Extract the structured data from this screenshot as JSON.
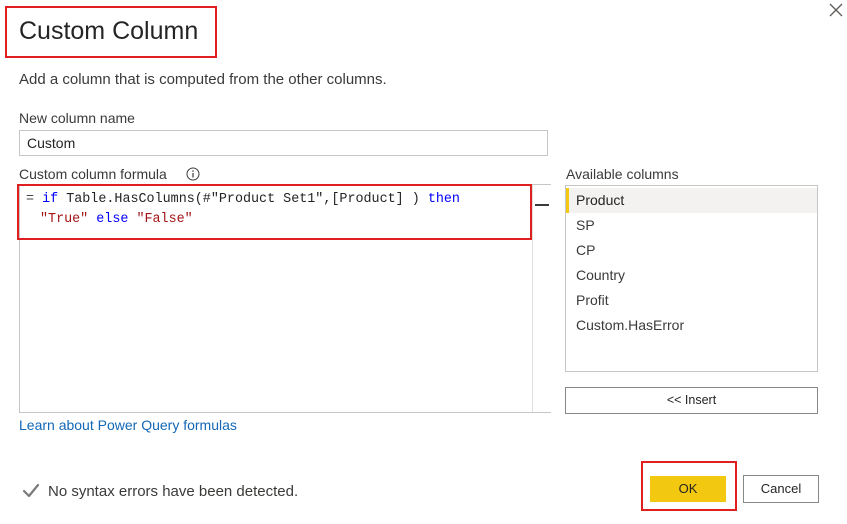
{
  "dialog": {
    "title": "Custom Column",
    "subtitle": "Add a column that is computed from the other columns."
  },
  "new_column": {
    "label": "New column name",
    "value": "Custom"
  },
  "formula": {
    "label": "Custom column formula",
    "line1": {
      "prefix": "= ",
      "if_kw": "if",
      "middle": " Table.HasColumns(#\"Product Set1\",[Product] ) ",
      "then_kw": "then"
    },
    "line2": {
      "true_str": "\"True\"",
      "else_kw": " else ",
      "false_str": "\"False\""
    }
  },
  "available_columns": {
    "label": "Available columns",
    "items": [
      "Product",
      "SP",
      "CP",
      "Country",
      "Profit",
      "Custom.HasError"
    ],
    "selected": "Product",
    "insert_label": "<< Insert"
  },
  "learn_link": "Learn about Power Query formulas",
  "status": {
    "text": "No syntax errors have been detected."
  },
  "buttons": {
    "ok": "OK",
    "cancel": "Cancel"
  },
  "colors": {
    "accent": "#f2c811",
    "highlight": "#e02020",
    "keyword": "#0000ff",
    "string": "#a31515",
    "link": "#1467b5",
    "check": "#7a7a7a"
  },
  "icons": {
    "close": "close-icon",
    "info": "info-icon",
    "status": "checkmark-icon"
  }
}
